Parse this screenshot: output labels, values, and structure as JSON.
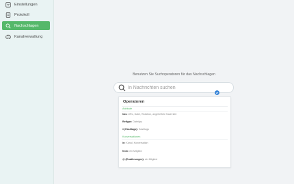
{
  "sidebar": {
    "items": [
      {
        "label": "Einstellungen",
        "icon": "settings-icon",
        "active": false
      },
      {
        "label": "Protokoll",
        "icon": "document-icon",
        "active": false
      },
      {
        "label": "Nachschlagen",
        "icon": "search-icon",
        "active": true
      },
      {
        "label": "Kanalverwaltung",
        "icon": "car-icon",
        "active": false
      }
    ]
  },
  "search": {
    "hint": "Benutzen Sie Suchoperatoren für das Nachschlagen",
    "placeholder": "In Nachrichten suchen"
  },
  "operators": {
    "title": "Operatoren",
    "sections": [
      {
        "label": "Attribute",
        "rows": [
          {
            "key": "has:",
            "desc": "URL, Datei, Reaktion, angeheftete Nachricht"
          },
          {
            "key": "Reftype:",
            "desc": "Dateityp"
          },
          {
            "key": "# (Hashtags):",
            "desc": "Hashtags"
          }
        ]
      },
      {
        "label": "Konversationen",
        "rows": [
          {
            "key": "in:",
            "desc": "Kanal, Konversation"
          },
          {
            "key": "from:",
            "desc": "ein Mitglied"
          },
          {
            "key": "@ (Erwähnungen):",
            "desc": "ein Mitglied"
          }
        ]
      }
    ]
  },
  "colors": {
    "accent": "#55b86a",
    "sidebar_bg": "#e9f3f3",
    "check_blue": "#2f7fd6"
  }
}
